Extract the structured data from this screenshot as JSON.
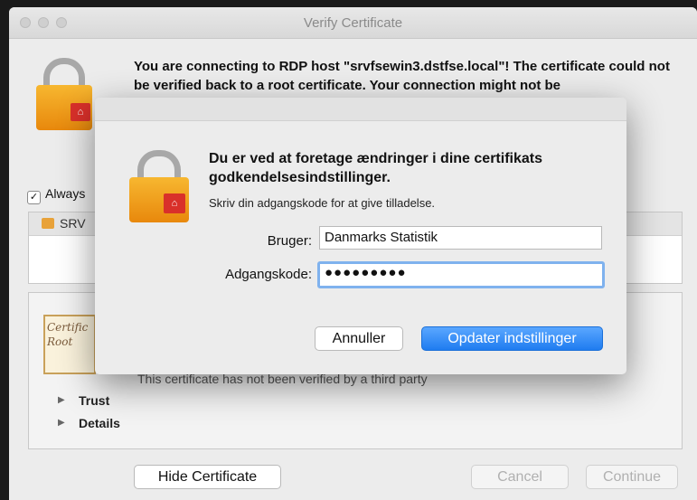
{
  "window": {
    "title": "Verify Certificate",
    "message": "You are connecting to RDP host \"srvfsewin3.dstfse.local\"! The certificate could not be verified back to a root certificate. Your connection might not be",
    "always_label": "Always",
    "cert_list": {
      "row_label": "SRV"
    },
    "detail": {
      "cert_image_text": "Certific Root",
      "status_text": "This certificate has not been verified by a third party",
      "trust_label": "Trust",
      "details_label": "Details"
    },
    "buttons": {
      "hide_certificate": "Hide Certificate",
      "cancel": "Cancel",
      "continue": "Continue"
    }
  },
  "auth_sheet": {
    "title": "Du er ved at foretage ændringer i dine certifikats godkendelsesindstillinger.",
    "subtitle": "Skriv din adgangskode for at give tilladelse.",
    "user_label": "Bruger:",
    "user_value": "Danmarks Statistik",
    "password_label": "Adgangskode:",
    "password_value": "●●●●●●●●●",
    "cancel_button": "Annuller",
    "update_button": "Opdater indstillinger"
  },
  "colors": {
    "accent": "#1f7cf0",
    "lock_gold": "#f0a020",
    "badge_red": "#d9302a"
  }
}
